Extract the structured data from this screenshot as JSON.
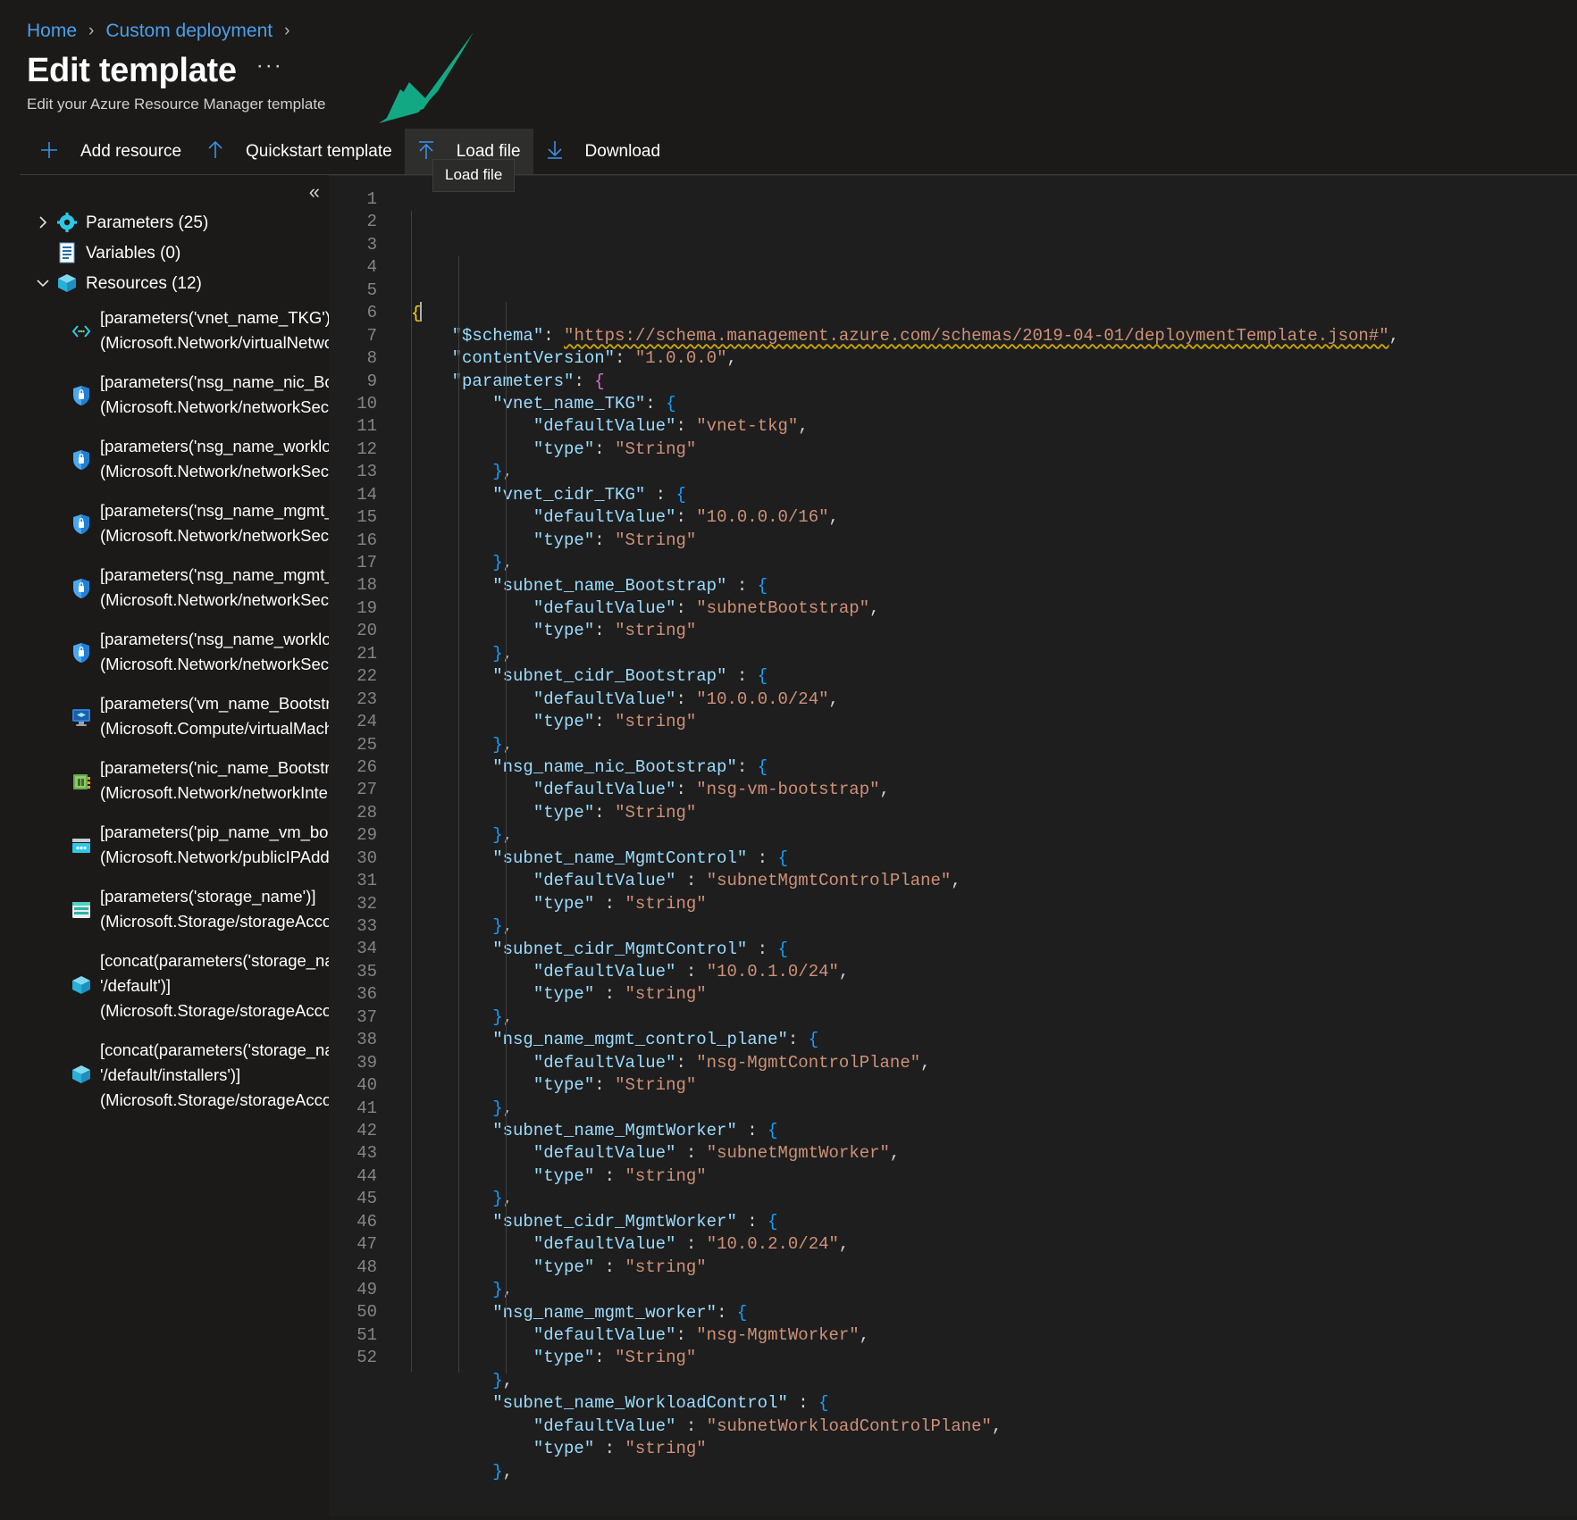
{
  "breadcrumb": {
    "items": [
      {
        "label": "Home"
      },
      {
        "label": "Custom deployment"
      }
    ],
    "separator": "›"
  },
  "header": {
    "title": "Edit template",
    "ellipsis": "···",
    "subtitle": "Edit your Azure Resource Manager template"
  },
  "commandbar": {
    "buttons": [
      {
        "label": "Add resource",
        "icon": "plus-icon"
      },
      {
        "label": "Quickstart template",
        "icon": "arrow-up-icon"
      },
      {
        "label": "Load file",
        "icon": "upload-icon",
        "active": true
      },
      {
        "label": "Download",
        "icon": "download-icon"
      }
    ]
  },
  "tooltip": {
    "text": "Load file"
  },
  "tree": {
    "collapse_label": "«",
    "nodes": [
      {
        "label": "Parameters (25)",
        "icon": "gear-icon",
        "chevron": "›",
        "expanded": false
      },
      {
        "label": "Variables (0)",
        "icon": "document-icon",
        "chevron": "",
        "expanded": false
      },
      {
        "label": "Resources (12)",
        "icon": "cube-icon",
        "chevron": "⌄",
        "expanded": true
      }
    ],
    "resources": [
      {
        "icon": "virtual-network-icon",
        "lines": [
          "[parameters('vnet_name_TKG')]",
          "(Microsoft.Network/virtualNetworl"
        ]
      },
      {
        "icon": "nsg-icon",
        "lines": [
          "[parameters('nsg_name_nic_Bootst",
          "(Microsoft.Network/networkSecuri"
        ]
      },
      {
        "icon": "nsg-icon",
        "lines": [
          "[parameters('nsg_name_workload_",
          "(Microsoft.Network/networkSecuri"
        ]
      },
      {
        "icon": "nsg-icon",
        "lines": [
          "[parameters('nsg_name_mgmt_cor",
          "(Microsoft.Network/networkSecuri"
        ]
      },
      {
        "icon": "nsg-icon",
        "lines": [
          "[parameters('nsg_name_mgmt_wo",
          "(Microsoft.Network/networkSecuri"
        ]
      },
      {
        "icon": "nsg-icon",
        "lines": [
          "[parameters('nsg_name_workload_",
          "(Microsoft.Network/networkSecuri"
        ]
      },
      {
        "icon": "virtual-machine-icon",
        "lines": [
          "[parameters('vm_name_Bootstrap'",
          "(Microsoft.Compute/virtualMachin"
        ]
      },
      {
        "icon": "network-interface-icon",
        "lines": [
          "[parameters('nic_name_Bootstrap')",
          "(Microsoft.Network/networkInterfa"
        ]
      },
      {
        "icon": "public-ip-icon",
        "lines": [
          "[parameters('pip_name_vm_bootst",
          "(Microsoft.Network/publicIPAddre"
        ]
      },
      {
        "icon": "storage-account-icon",
        "lines": [
          "[parameters('storage_name')]",
          "(Microsoft.Storage/storageAccoun"
        ]
      },
      {
        "icon": "cube-icon",
        "lines": [
          "[concat(parameters('storage_name",
          "'/default')]",
          "(Microsoft.Storage/storageAccoun"
        ]
      },
      {
        "icon": "cube-icon",
        "lines": [
          "[concat(parameters('storage_name",
          "'/default/installers')]",
          "(Microsoft.Storage/storageAccoun"
        ]
      }
    ]
  },
  "editor": {
    "first_line": 1,
    "last_line": 52,
    "lines": [
      {
        "n": 1,
        "indent": 0,
        "tokens": [
          {
            "t": "{",
            "c": "b1"
          }
        ],
        "cursor": true
      },
      {
        "n": 2,
        "indent": 1,
        "tokens": [
          {
            "t": "\"$schema\"",
            "c": "k"
          },
          {
            "t": ": ",
            "c": "p"
          },
          {
            "t": "\"https://schema.management.azure.com/schemas/2019-04-01/deploymentTemplate.json#\"",
            "c": "url"
          },
          {
            "t": ",",
            "c": "p"
          }
        ]
      },
      {
        "n": 3,
        "indent": 1,
        "tokens": [
          {
            "t": "\"contentVersion\"",
            "c": "k"
          },
          {
            "t": ": ",
            "c": "p"
          },
          {
            "t": "\"1.0.0.0\"",
            "c": "s"
          },
          {
            "t": ",",
            "c": "p"
          }
        ]
      },
      {
        "n": 4,
        "indent": 1,
        "tokens": [
          {
            "t": "\"parameters\"",
            "c": "k"
          },
          {
            "t": ": ",
            "c": "p"
          },
          {
            "t": "{",
            "c": "b2"
          }
        ]
      },
      {
        "n": 5,
        "indent": 2,
        "tokens": [
          {
            "t": "\"vnet_name_TKG\"",
            "c": "k"
          },
          {
            "t": ": ",
            "c": "p"
          },
          {
            "t": "{",
            "c": "b3"
          }
        ]
      },
      {
        "n": 6,
        "indent": 3,
        "tokens": [
          {
            "t": "\"defaultValue\"",
            "c": "k"
          },
          {
            "t": ": ",
            "c": "p"
          },
          {
            "t": "\"vnet-tkg\"",
            "c": "s"
          },
          {
            "t": ",",
            "c": "p"
          }
        ]
      },
      {
        "n": 7,
        "indent": 3,
        "tokens": [
          {
            "t": "\"type\"",
            "c": "k"
          },
          {
            "t": ": ",
            "c": "p"
          },
          {
            "t": "\"String\"",
            "c": "s"
          }
        ]
      },
      {
        "n": 8,
        "indent": 2,
        "tokens": [
          {
            "t": "}",
            "c": "b3"
          },
          {
            "t": ",",
            "c": "p"
          }
        ]
      },
      {
        "n": 9,
        "indent": 2,
        "tokens": [
          {
            "t": "\"vnet_cidr_TKG\"",
            "c": "k"
          },
          {
            "t": " : ",
            "c": "p"
          },
          {
            "t": "{",
            "c": "b3"
          }
        ]
      },
      {
        "n": 10,
        "indent": 3,
        "tokens": [
          {
            "t": "\"defaultValue\"",
            "c": "k"
          },
          {
            "t": ": ",
            "c": "p"
          },
          {
            "t": "\"10.0.0.0/16\"",
            "c": "s"
          },
          {
            "t": ",",
            "c": "p"
          }
        ]
      },
      {
        "n": 11,
        "indent": 3,
        "tokens": [
          {
            "t": "\"type\"",
            "c": "k"
          },
          {
            "t": ": ",
            "c": "p"
          },
          {
            "t": "\"String\"",
            "c": "s"
          }
        ]
      },
      {
        "n": 12,
        "indent": 2,
        "tokens": [
          {
            "t": "}",
            "c": "b3"
          },
          {
            "t": ",",
            "c": "p"
          }
        ]
      },
      {
        "n": 13,
        "indent": 2,
        "tokens": [
          {
            "t": "\"subnet_name_Bootstrap\"",
            "c": "k"
          },
          {
            "t": " : ",
            "c": "p"
          },
          {
            "t": "{",
            "c": "b3"
          }
        ]
      },
      {
        "n": 14,
        "indent": 3,
        "tokens": [
          {
            "t": "\"defaultValue\"",
            "c": "k"
          },
          {
            "t": ": ",
            "c": "p"
          },
          {
            "t": "\"subnetBootstrap\"",
            "c": "s"
          },
          {
            "t": ",",
            "c": "p"
          }
        ]
      },
      {
        "n": 15,
        "indent": 3,
        "tokens": [
          {
            "t": "\"type\"",
            "c": "k"
          },
          {
            "t": ": ",
            "c": "p"
          },
          {
            "t": "\"string\"",
            "c": "s"
          }
        ]
      },
      {
        "n": 16,
        "indent": 2,
        "tokens": [
          {
            "t": "}",
            "c": "b3"
          },
          {
            "t": ",",
            "c": "p"
          }
        ]
      },
      {
        "n": 17,
        "indent": 2,
        "tokens": [
          {
            "t": "\"subnet_cidr_Bootstrap\"",
            "c": "k"
          },
          {
            "t": " : ",
            "c": "p"
          },
          {
            "t": "{",
            "c": "b3"
          }
        ]
      },
      {
        "n": 18,
        "indent": 3,
        "tokens": [
          {
            "t": "\"defaultValue\"",
            "c": "k"
          },
          {
            "t": ": ",
            "c": "p"
          },
          {
            "t": "\"10.0.0.0/24\"",
            "c": "s"
          },
          {
            "t": ",",
            "c": "p"
          }
        ]
      },
      {
        "n": 19,
        "indent": 3,
        "tokens": [
          {
            "t": "\"type\"",
            "c": "k"
          },
          {
            "t": ": ",
            "c": "p"
          },
          {
            "t": "\"string\"",
            "c": "s"
          }
        ]
      },
      {
        "n": 20,
        "indent": 2,
        "tokens": [
          {
            "t": "}",
            "c": "b3"
          },
          {
            "t": ",",
            "c": "p"
          }
        ]
      },
      {
        "n": 21,
        "indent": 2,
        "tokens": [
          {
            "t": "\"nsg_name_nic_Bootstrap\"",
            "c": "k"
          },
          {
            "t": ": ",
            "c": "p"
          },
          {
            "t": "{",
            "c": "b3"
          }
        ]
      },
      {
        "n": 22,
        "indent": 3,
        "tokens": [
          {
            "t": "\"defaultValue\"",
            "c": "k"
          },
          {
            "t": ": ",
            "c": "p"
          },
          {
            "t": "\"nsg-vm-bootstrap\"",
            "c": "s"
          },
          {
            "t": ",",
            "c": "p"
          }
        ]
      },
      {
        "n": 23,
        "indent": 3,
        "tokens": [
          {
            "t": "\"type\"",
            "c": "k"
          },
          {
            "t": ": ",
            "c": "p"
          },
          {
            "t": "\"String\"",
            "c": "s"
          }
        ]
      },
      {
        "n": 24,
        "indent": 2,
        "tokens": [
          {
            "t": "}",
            "c": "b3"
          },
          {
            "t": ",",
            "c": "p"
          }
        ]
      },
      {
        "n": 25,
        "indent": 2,
        "tokens": [
          {
            "t": "\"subnet_name_MgmtControl\"",
            "c": "k"
          },
          {
            "t": " : ",
            "c": "p"
          },
          {
            "t": "{",
            "c": "b3"
          }
        ]
      },
      {
        "n": 26,
        "indent": 3,
        "tokens": [
          {
            "t": "\"defaultValue\"",
            "c": "k"
          },
          {
            "t": " : ",
            "c": "p"
          },
          {
            "t": "\"subnetMgmtControlPlane\"",
            "c": "s"
          },
          {
            "t": ",",
            "c": "p"
          }
        ]
      },
      {
        "n": 27,
        "indent": 3,
        "tokens": [
          {
            "t": "\"type\"",
            "c": "k"
          },
          {
            "t": " : ",
            "c": "p"
          },
          {
            "t": "\"string\"",
            "c": "s"
          }
        ]
      },
      {
        "n": 28,
        "indent": 2,
        "tokens": [
          {
            "t": "}",
            "c": "b3"
          },
          {
            "t": ",",
            "c": "p"
          }
        ]
      },
      {
        "n": 29,
        "indent": 2,
        "tokens": [
          {
            "t": "\"subnet_cidr_MgmtControl\"",
            "c": "k"
          },
          {
            "t": " : ",
            "c": "p"
          },
          {
            "t": "{",
            "c": "b3"
          }
        ]
      },
      {
        "n": 30,
        "indent": 3,
        "tokens": [
          {
            "t": "\"defaultValue\"",
            "c": "k"
          },
          {
            "t": " : ",
            "c": "p"
          },
          {
            "t": "\"10.0.1.0/24\"",
            "c": "s"
          },
          {
            "t": ",",
            "c": "p"
          }
        ]
      },
      {
        "n": 31,
        "indent": 3,
        "tokens": [
          {
            "t": "\"type\"",
            "c": "k"
          },
          {
            "t": " : ",
            "c": "p"
          },
          {
            "t": "\"string\"",
            "c": "s"
          }
        ]
      },
      {
        "n": 32,
        "indent": 2,
        "tokens": [
          {
            "t": "}",
            "c": "b3"
          },
          {
            "t": ",",
            "c": "p"
          }
        ]
      },
      {
        "n": 33,
        "indent": 2,
        "tokens": [
          {
            "t": "\"nsg_name_mgmt_control_plane\"",
            "c": "k"
          },
          {
            "t": ": ",
            "c": "p"
          },
          {
            "t": "{",
            "c": "b3"
          }
        ]
      },
      {
        "n": 34,
        "indent": 3,
        "tokens": [
          {
            "t": "\"defaultValue\"",
            "c": "k"
          },
          {
            "t": ": ",
            "c": "p"
          },
          {
            "t": "\"nsg-MgmtControlPlane\"",
            "c": "s"
          },
          {
            "t": ",",
            "c": "p"
          }
        ]
      },
      {
        "n": 35,
        "indent": 3,
        "tokens": [
          {
            "t": "\"type\"",
            "c": "k"
          },
          {
            "t": ": ",
            "c": "p"
          },
          {
            "t": "\"String\"",
            "c": "s"
          }
        ]
      },
      {
        "n": 36,
        "indent": 2,
        "tokens": [
          {
            "t": "}",
            "c": "b3"
          },
          {
            "t": ",",
            "c": "p"
          }
        ]
      },
      {
        "n": 37,
        "indent": 2,
        "tokens": [
          {
            "t": "\"subnet_name_MgmtWorker\"",
            "c": "k"
          },
          {
            "t": " : ",
            "c": "p"
          },
          {
            "t": "{",
            "c": "b3"
          }
        ]
      },
      {
        "n": 38,
        "indent": 3,
        "tokens": [
          {
            "t": "\"defaultValue\"",
            "c": "k"
          },
          {
            "t": " : ",
            "c": "p"
          },
          {
            "t": "\"subnetMgmtWorker\"",
            "c": "s"
          },
          {
            "t": ",",
            "c": "p"
          }
        ]
      },
      {
        "n": 39,
        "indent": 3,
        "tokens": [
          {
            "t": "\"type\"",
            "c": "k"
          },
          {
            "t": " : ",
            "c": "p"
          },
          {
            "t": "\"string\"",
            "c": "s"
          }
        ]
      },
      {
        "n": 40,
        "indent": 2,
        "tokens": [
          {
            "t": "}",
            "c": "b3"
          },
          {
            "t": ",",
            "c": "p"
          }
        ]
      },
      {
        "n": 41,
        "indent": 2,
        "tokens": [
          {
            "t": "\"subnet_cidr_MgmtWorker\"",
            "c": "k"
          },
          {
            "t": " : ",
            "c": "p"
          },
          {
            "t": "{",
            "c": "b3"
          }
        ]
      },
      {
        "n": 42,
        "indent": 3,
        "tokens": [
          {
            "t": "\"defaultValue\"",
            "c": "k"
          },
          {
            "t": " : ",
            "c": "p"
          },
          {
            "t": "\"10.0.2.0/24\"",
            "c": "s"
          },
          {
            "t": ",",
            "c": "p"
          }
        ]
      },
      {
        "n": 43,
        "indent": 3,
        "tokens": [
          {
            "t": "\"type\"",
            "c": "k"
          },
          {
            "t": " : ",
            "c": "p"
          },
          {
            "t": "\"string\"",
            "c": "s"
          }
        ]
      },
      {
        "n": 44,
        "indent": 2,
        "tokens": [
          {
            "t": "}",
            "c": "b3"
          },
          {
            "t": ",",
            "c": "p"
          }
        ]
      },
      {
        "n": 45,
        "indent": 2,
        "tokens": [
          {
            "t": "\"nsg_name_mgmt_worker\"",
            "c": "k"
          },
          {
            "t": ": ",
            "c": "p"
          },
          {
            "t": "{",
            "c": "b3"
          }
        ]
      },
      {
        "n": 46,
        "indent": 3,
        "tokens": [
          {
            "t": "\"defaultValue\"",
            "c": "k"
          },
          {
            "t": ": ",
            "c": "p"
          },
          {
            "t": "\"nsg-MgmtWorker\"",
            "c": "s"
          },
          {
            "t": ",",
            "c": "p"
          }
        ]
      },
      {
        "n": 47,
        "indent": 3,
        "tokens": [
          {
            "t": "\"type\"",
            "c": "k"
          },
          {
            "t": ": ",
            "c": "p"
          },
          {
            "t": "\"String\"",
            "c": "s"
          }
        ]
      },
      {
        "n": 48,
        "indent": 2,
        "tokens": [
          {
            "t": "}",
            "c": "b3"
          },
          {
            "t": ",",
            "c": "p"
          }
        ]
      },
      {
        "n": 49,
        "indent": 2,
        "tokens": [
          {
            "t": "\"subnet_name_WorkloadControl\"",
            "c": "k"
          },
          {
            "t": " : ",
            "c": "p"
          },
          {
            "t": "{",
            "c": "b3"
          }
        ]
      },
      {
        "n": 50,
        "indent": 3,
        "tokens": [
          {
            "t": "\"defaultValue\"",
            "c": "k"
          },
          {
            "t": " : ",
            "c": "p"
          },
          {
            "t": "\"subnetWorkloadControlPlane\"",
            "c": "s"
          },
          {
            "t": ",",
            "c": "p"
          }
        ]
      },
      {
        "n": 51,
        "indent": 3,
        "tokens": [
          {
            "t": "\"type\"",
            "c": "k"
          },
          {
            "t": " : ",
            "c": "p"
          },
          {
            "t": "\"string\"",
            "c": "s"
          }
        ]
      },
      {
        "n": 52,
        "indent": 2,
        "tokens": [
          {
            "t": "}",
            "c": "b3"
          },
          {
            "t": ",",
            "c": "p"
          }
        ]
      }
    ]
  },
  "colors": {
    "background": "#1b1a19",
    "editor_background": "#1e1e1e",
    "link": "#4aa0e8",
    "accent": "#3b8fe0",
    "annotation_arrow": "#13a884",
    "key": "#9cdcfe",
    "string": "#ce9178",
    "line_number": "#858585"
  }
}
